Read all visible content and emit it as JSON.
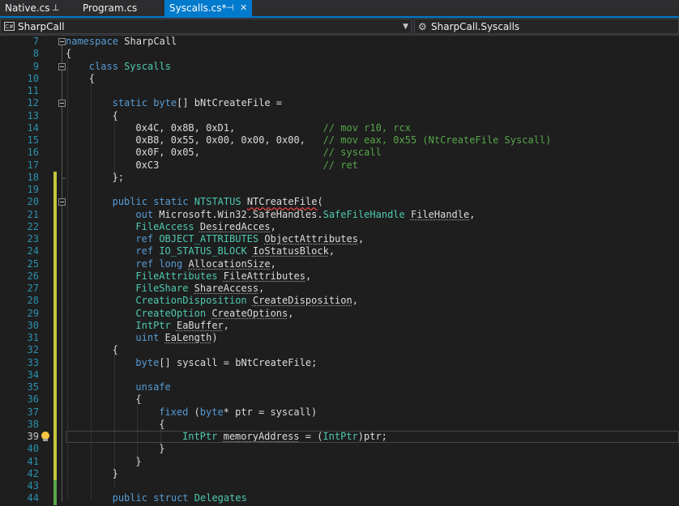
{
  "tabs": [
    {
      "label": "Native.cs",
      "pin": "⊥",
      "active": false
    },
    {
      "label": "Program.cs",
      "active": false
    },
    {
      "label": "Syscalls.cs*",
      "pin": "⊣",
      "close": "✕",
      "active": true
    }
  ],
  "nav": {
    "project": "SharpCall",
    "project_icon": "C#",
    "member": "SharpCall.Syscalls"
  },
  "editor": {
    "current_line": 39,
    "lines": [
      {
        "n": 7,
        "text": "namespace SharpCall"
      },
      {
        "n": 8,
        "text": "{"
      },
      {
        "n": 9,
        "text": "class Syscalls"
      },
      {
        "n": 10,
        "text": "{"
      },
      {
        "n": 11,
        "text": ""
      },
      {
        "n": 12,
        "text": "static byte[] bNtCreateFile ="
      },
      {
        "n": 13,
        "text": "{"
      },
      {
        "n": 14,
        "text": "0x4C, 0x8B, 0xD1,               // mov r10, rcx"
      },
      {
        "n": 15,
        "text": "0xB8, 0x55, 0x00, 0x00, 0x00,   // mov eax, 0x55 (NtCreateFile Syscall)"
      },
      {
        "n": 16,
        "text": "0x0F, 0x05,                     // syscall"
      },
      {
        "n": 17,
        "text": "0xC3                            // ret"
      },
      {
        "n": 18,
        "text": "};"
      },
      {
        "n": 19,
        "text": ""
      },
      {
        "n": 20,
        "text": "public static NTSTATUS NTCreateFile("
      },
      {
        "n": 21,
        "text": "out Microsoft.Win32.SafeHandles.SafeFileHandle FileHandle,"
      },
      {
        "n": 22,
        "text": "FileAccess DesiredAcces,"
      },
      {
        "n": 23,
        "text": "ref OBJECT_ATTRIBUTES ObjectAttributes,"
      },
      {
        "n": 24,
        "text": "ref IO_STATUS_BLOCK IoStatusBlock,"
      },
      {
        "n": 25,
        "text": "ref long AllocationSize,"
      },
      {
        "n": 26,
        "text": "FileAttributes FileAttributes,"
      },
      {
        "n": 27,
        "text": "FileShare ShareAccess,"
      },
      {
        "n": 28,
        "text": "CreationDisposition CreateDisposition,"
      },
      {
        "n": 29,
        "text": "CreateOption CreateOptions,"
      },
      {
        "n": 30,
        "text": "IntPtr EaBuffer,"
      },
      {
        "n": 31,
        "text": "uint EaLength)"
      },
      {
        "n": 32,
        "text": "{"
      },
      {
        "n": 33,
        "text": "byte[] syscall = bNtCreateFile;"
      },
      {
        "n": 34,
        "text": ""
      },
      {
        "n": 35,
        "text": "unsafe"
      },
      {
        "n": 36,
        "text": "{"
      },
      {
        "n": 37,
        "text": "fixed (byte* ptr = syscall)"
      },
      {
        "n": 38,
        "text": "{"
      },
      {
        "n": 39,
        "text": "IntPtr memoryAddress = (IntPtr)ptr;"
      },
      {
        "n": 40,
        "text": "}"
      },
      {
        "n": 41,
        "text": "}"
      },
      {
        "n": 42,
        "text": "}"
      },
      {
        "n": 43,
        "text": ""
      },
      {
        "n": 44,
        "text": "public struct Delegates"
      }
    ]
  },
  "colors": {
    "keyword": "#569cd6",
    "type": "#4ec9b0",
    "comment": "#57a64a",
    "line_number": "#2b91af",
    "change_saved": "#57a64a",
    "change_unsaved": "#c5c53a",
    "accent": "#007acc"
  }
}
